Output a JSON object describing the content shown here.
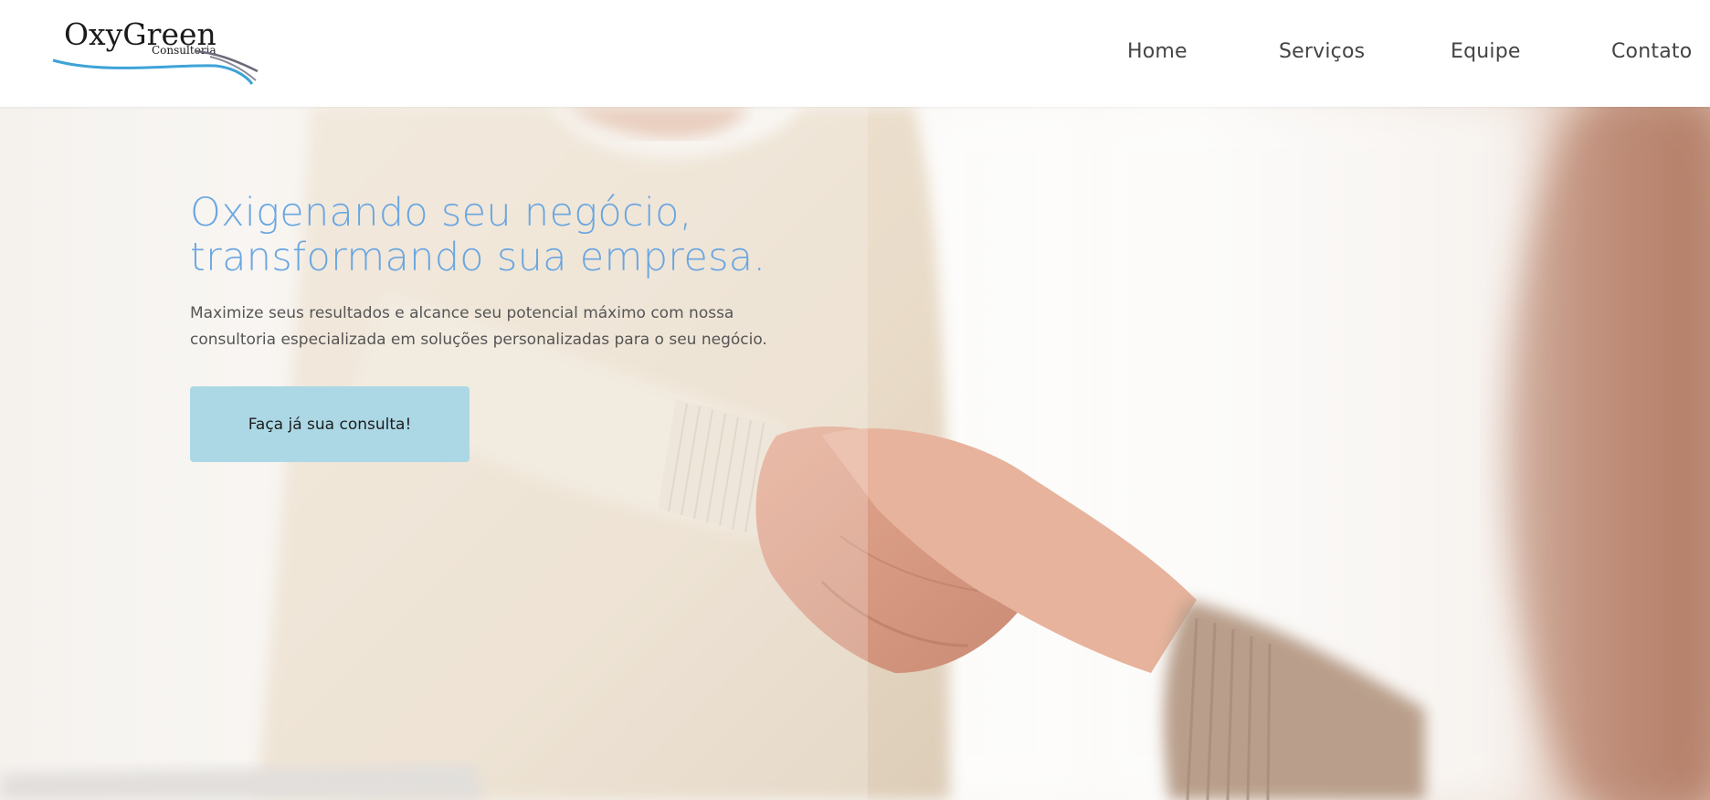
{
  "brand": {
    "name": "OxyGreen",
    "tagline": "Consultoria"
  },
  "nav": {
    "items": [
      {
        "label": "Home"
      },
      {
        "label": "Serviços"
      },
      {
        "label": "Equipe"
      },
      {
        "label": "Contato"
      }
    ]
  },
  "hero": {
    "headline_line1": "Oxigenando seu negócio,",
    "headline_line2": "transformando sua empresa.",
    "subtext_line1": "Maximize seus resultados e alcance seu potencial máximo com nossa",
    "subtext_line2": "consultoria especializada em soluções personalizadas para o seu negócio.",
    "cta_label": "Faça já sua consulta!",
    "background_image": "handshake-photo"
  },
  "colors": {
    "headline": "#6aa6e0",
    "cta_background": "#acd8e5",
    "logo_swoosh": "#3ea3d8"
  }
}
